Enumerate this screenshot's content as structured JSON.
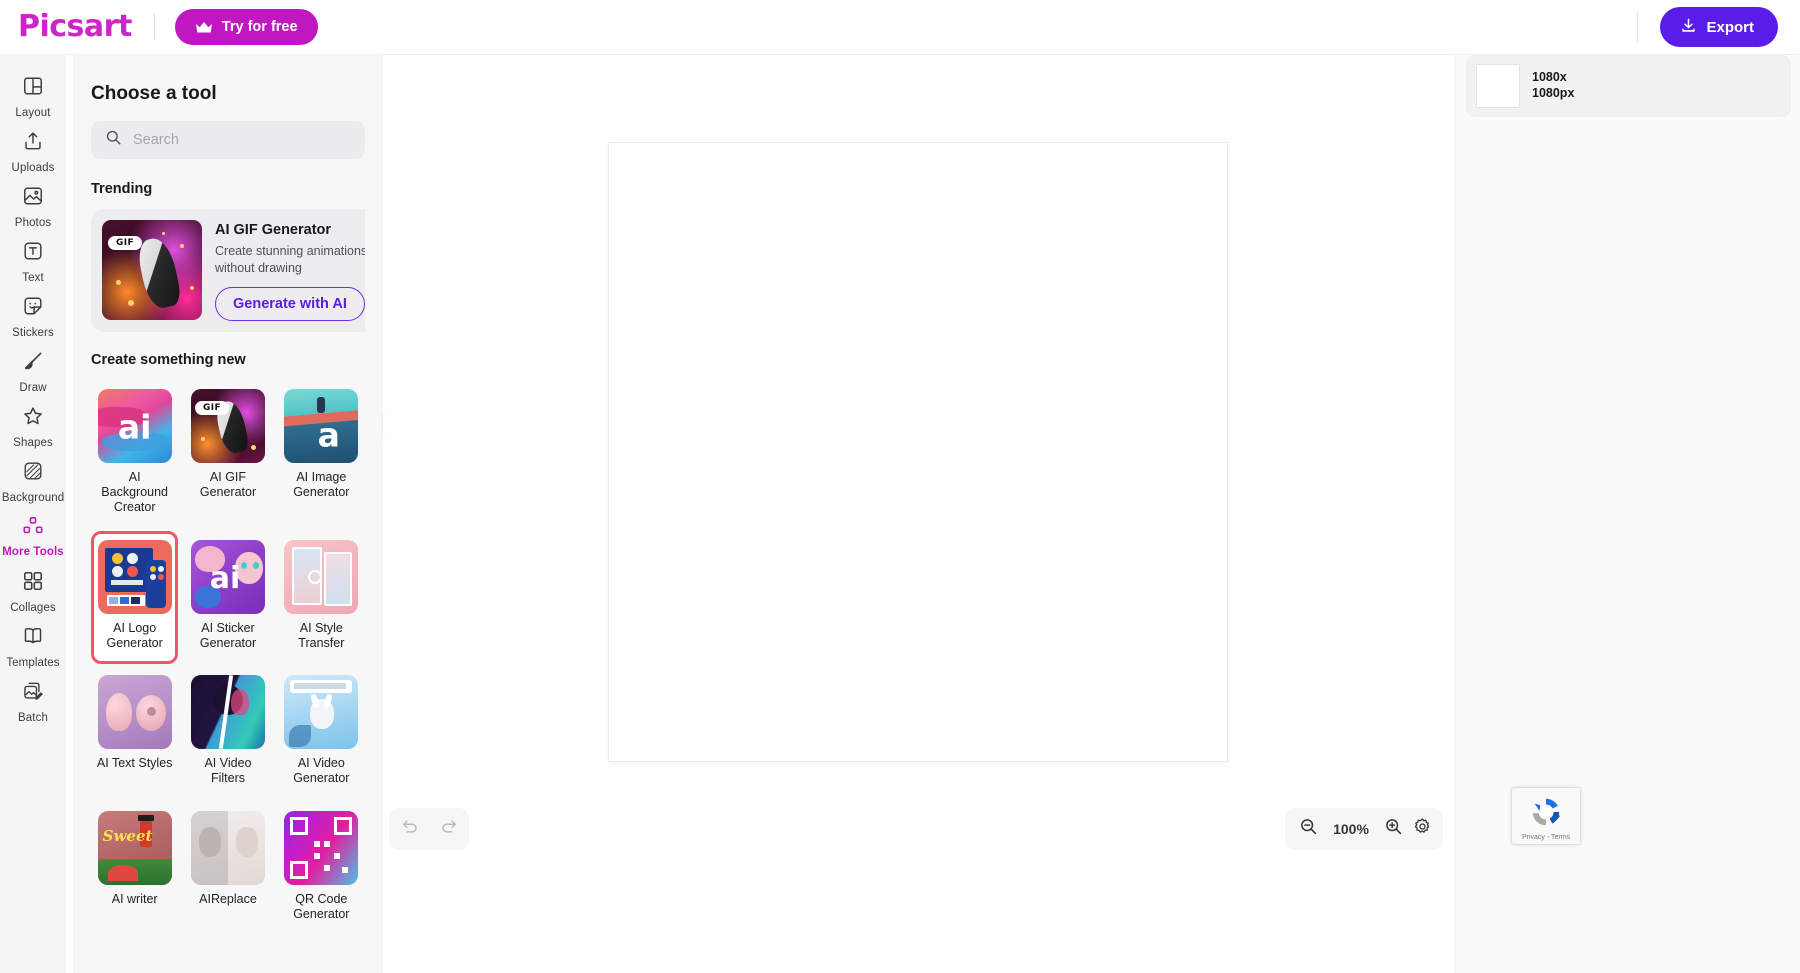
{
  "topbar": {
    "brand": "Picsart",
    "try_free_label": "Try for free",
    "try_free_icon": "crown-icon",
    "export_label": "Export",
    "export_icon": "download-icon",
    "accent_magenta": "#c017c0",
    "accent_purple": "#5a1ce8"
  },
  "sidebar": {
    "items": [
      {
        "label": "Layout",
        "icon": "layout-icon",
        "active": false
      },
      {
        "label": "Uploads",
        "icon": "upload-icon",
        "active": false
      },
      {
        "label": "Photos",
        "icon": "photo-icon",
        "active": false
      },
      {
        "label": "Text",
        "icon": "text-icon",
        "active": false
      },
      {
        "label": "Stickers",
        "icon": "sticker-icon",
        "active": false
      },
      {
        "label": "Draw",
        "icon": "brush-icon",
        "active": false
      },
      {
        "label": "Shapes",
        "icon": "star-icon",
        "active": false
      },
      {
        "label": "Background",
        "icon": "background-icon",
        "active": false
      },
      {
        "label": "More Tools",
        "icon": "more-tools-icon",
        "active": true
      },
      {
        "label": "Collages",
        "icon": "collage-icon",
        "active": false
      },
      {
        "label": "Templates",
        "icon": "templates-icon",
        "active": false
      },
      {
        "label": "Batch",
        "icon": "batch-icon",
        "active": false
      }
    ]
  },
  "panel": {
    "title": "Choose a tool",
    "search": {
      "placeholder": "Search",
      "value": "",
      "icon": "search-icon"
    },
    "trending": {
      "section_title": "Trending",
      "card": {
        "badge": "GIF",
        "name": "AI GIF Generator",
        "description": "Create stunning animations without drawing",
        "cta": "Generate with AI"
      }
    },
    "create_new": {
      "section_title": "Create something new",
      "tools": [
        {
          "label": "AI Background Creator",
          "selected": false
        },
        {
          "label": "AI GIF Generator",
          "selected": false
        },
        {
          "label": "AI Image Generator",
          "selected": false
        },
        {
          "label": "AI Logo Generator",
          "selected": true
        },
        {
          "label": "AI Sticker Generator",
          "selected": false
        },
        {
          "label": "AI Style Transfer",
          "selected": false
        },
        {
          "label": "AI Text Styles",
          "selected": false
        },
        {
          "label": "AI Video Filters",
          "selected": false
        },
        {
          "label": "AI Video Generator",
          "selected": false
        },
        {
          "label": "AI writer",
          "selected": false
        },
        {
          "label": "AIReplace",
          "selected": false
        },
        {
          "label": "QR Code Generator",
          "selected": false
        }
      ],
      "selection_highlight_color": "#f4546b"
    },
    "collapse_icon": "chevron-left-icon",
    "expand_icon": "chevron-right-icon"
  },
  "canvas": {
    "zoom_level": "100%",
    "zoom_out_icon": "zoom-out-icon",
    "zoom_in_icon": "zoom-in-icon",
    "settings_icon": "gear-icon",
    "undo_icon": "undo-icon",
    "redo_icon": "redo-icon"
  },
  "right_panel": {
    "page_size_line1": "1080x",
    "page_size_line2": "1080px"
  },
  "recaptcha": {
    "privacy_terms": "Privacy - Terms"
  }
}
